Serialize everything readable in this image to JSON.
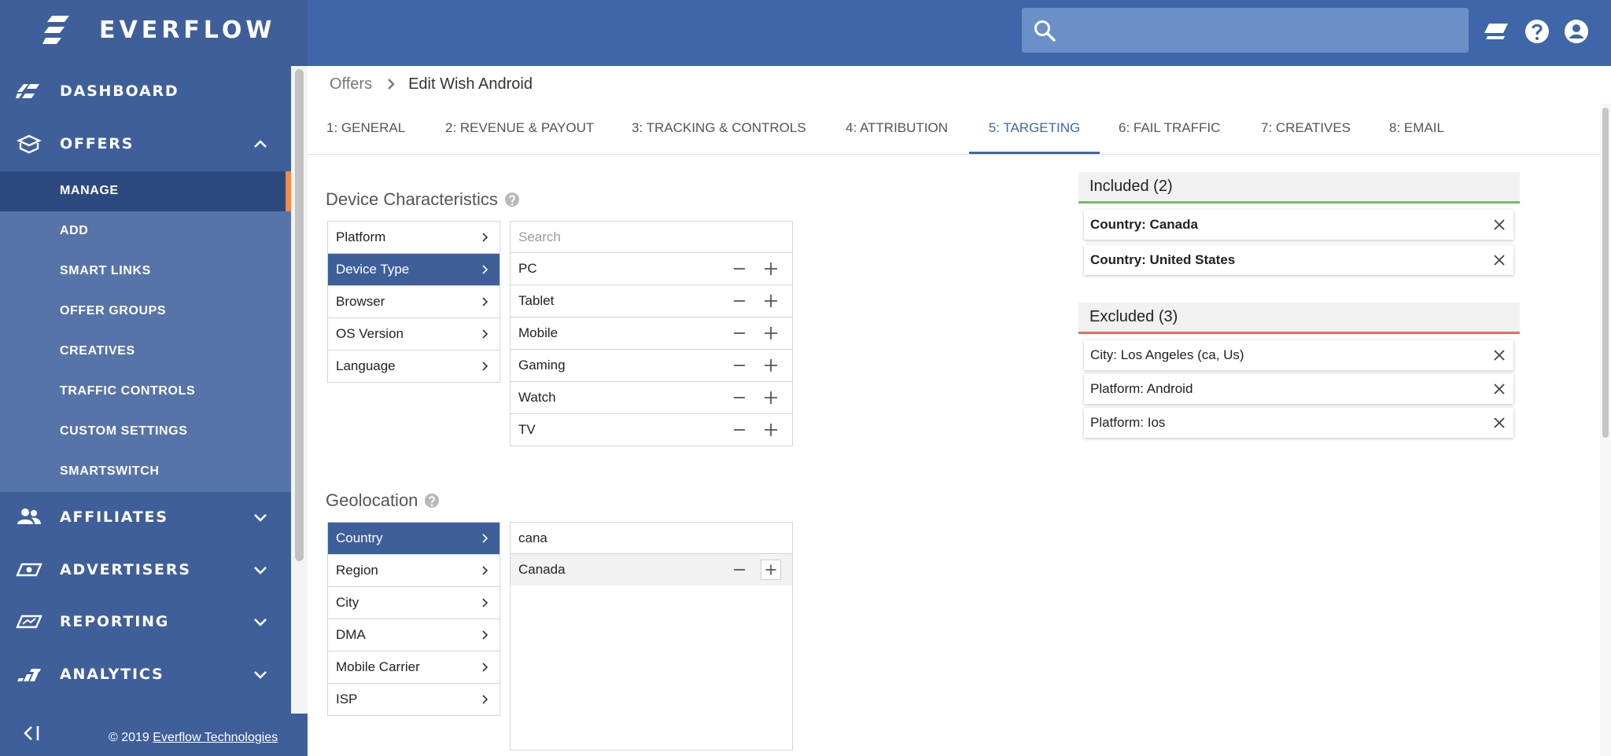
{
  "brand": {
    "name": "EVERFLOW"
  },
  "sidebar": {
    "main_items": [
      {
        "label": "DASHBOARD",
        "icon": "dashboard-icon"
      },
      {
        "label": "OFFERS",
        "icon": "offers-box-icon",
        "expanded": true
      },
      {
        "label": "AFFILIATES",
        "icon": "affiliates-icon"
      },
      {
        "label": "ADVERTISERS",
        "icon": "advertisers-icon"
      },
      {
        "label": "REPORTING",
        "icon": "reporting-icon"
      },
      {
        "label": "ANALYTICS",
        "icon": "analytics-icon"
      }
    ],
    "sub_items": [
      {
        "label": "MANAGE",
        "active": true
      },
      {
        "label": "ADD"
      },
      {
        "label": "SMART LINKS"
      },
      {
        "label": "OFFER GROUPS"
      },
      {
        "label": "CREATIVES"
      },
      {
        "label": "TRAFFIC CONTROLS"
      },
      {
        "label": "CUSTOM SETTINGS"
      },
      {
        "label": "SMARTSWITCH"
      }
    ],
    "footer": {
      "copyright_prefix": "© 2019 ",
      "copyright_link": "Everflow Technologies"
    }
  },
  "topbar": {
    "search_placeholder": ""
  },
  "breadcrumb": {
    "root": "Offers",
    "current": "Edit Wish Android"
  },
  "tabs": [
    {
      "label": "1: GENERAL"
    },
    {
      "label": "2: REVENUE & PAYOUT"
    },
    {
      "label": "3: TRACKING & CONTROLS"
    },
    {
      "label": "4: ATTRIBUTION"
    },
    {
      "label": "5: TARGETING",
      "active": true
    },
    {
      "label": "6: FAIL TRAFFIC"
    },
    {
      "label": "7: CREATIVES"
    },
    {
      "label": "8: EMAIL"
    }
  ],
  "device": {
    "title": "Device Characteristics",
    "categories": [
      "Platform",
      "Device Type",
      "Browser",
      "OS Version",
      "Language"
    ],
    "selected_category": "Device Type",
    "search_placeholder": "Search",
    "options": [
      "PC",
      "Tablet",
      "Mobile",
      "Gaming",
      "Watch",
      "TV"
    ]
  },
  "geo": {
    "title": "Geolocation",
    "categories": [
      "Country",
      "Region",
      "City",
      "DMA",
      "Mobile Carrier",
      "ISP"
    ],
    "selected_category": "Country",
    "search_value": "cana",
    "options": [
      "Canada"
    ]
  },
  "included": {
    "title": "Included (2)",
    "items": [
      "Country: Canada",
      "Country: United States"
    ]
  },
  "excluded": {
    "title": "Excluded (3)",
    "items": [
      "City: Los Angeles (ca, Us)",
      "Platform: Android",
      "Platform: Ios"
    ]
  },
  "colors": {
    "sidebar": "#3f5f9a",
    "topbar": "#3f66a9",
    "active_accent": "#f08b4f",
    "included_line": "#6cbf5f",
    "excluded_line": "#e36c67"
  }
}
